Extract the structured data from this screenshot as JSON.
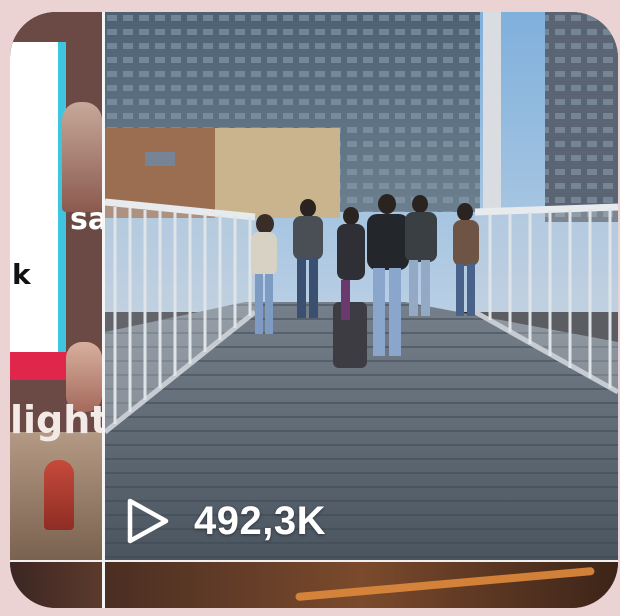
{
  "video_card": {
    "view_count": "492,3K",
    "play_icon": "play-icon",
    "side_thumbnail_text": {
      "fragment_a": "sa",
      "fragment_b": "k",
      "fragment_c": "light"
    }
  },
  "colors": {
    "background": "#ead3d2",
    "count_text": "#ffffff",
    "accent_cyan": "#3fc6de",
    "accent_red": "#e0264a"
  }
}
